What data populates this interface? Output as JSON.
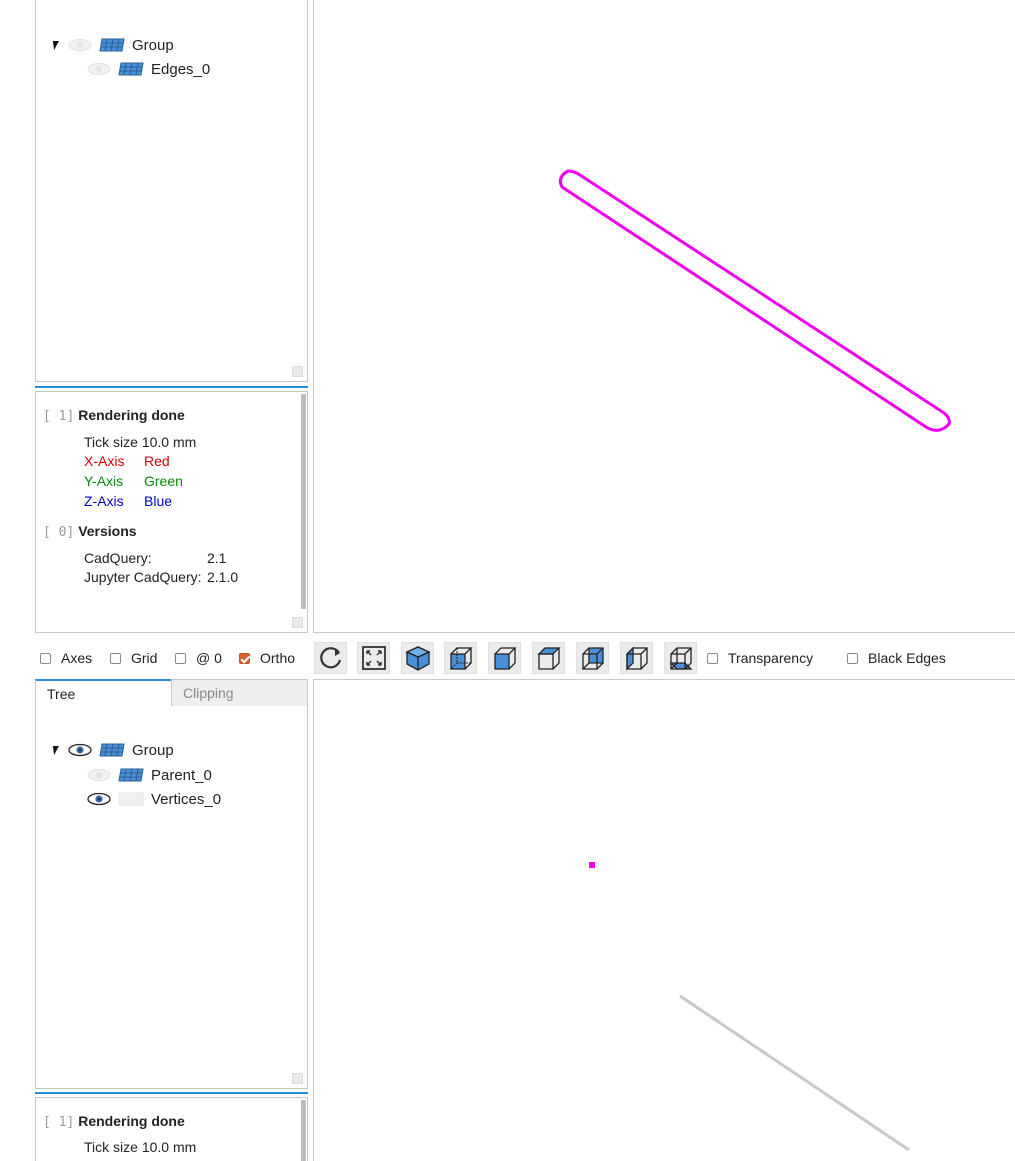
{
  "top_panel": {
    "tree": [
      {
        "label": "Group",
        "eye": "eye-hidden-icon",
        "shape": "shape-faces-icon",
        "expanded": true
      },
      {
        "label": "Edges_0",
        "eye": "eye-hidden-icon",
        "shape": "shape-faces-icon"
      }
    ],
    "log": {
      "entry1": {
        "index": "[ 1]",
        "title": "Rendering done"
      },
      "tick_label": "Tick size",
      "tick_value": "10.0 mm",
      "x_axis": "X-Axis",
      "x_color": "Red",
      "y_axis": "Y-Axis",
      "y_color": "Green",
      "z_axis": "Z-Axis",
      "z_color": "Blue",
      "entry0": {
        "index": "[ 0]",
        "title": "Versions"
      },
      "cadquery_label": "CadQuery:",
      "cadquery_value": "2.1",
      "jupyter_label": "Jupyter CadQuery:",
      "jupyter_value": "2.1.0"
    }
  },
  "toolbar": {
    "axes": {
      "label": "Axes",
      "checked": false
    },
    "grid": {
      "label": "Grid",
      "checked": false
    },
    "at_zero": {
      "label": "@ 0",
      "checked": false
    },
    "ortho": {
      "label": "Ortho",
      "checked": true
    },
    "transparency": {
      "label": "Transparency",
      "checked": false
    },
    "black_edges": {
      "label": "Black Edges",
      "checked": false
    },
    "buttons": [
      "reset-view-icon",
      "fit-view-icon",
      "isometric-view-icon",
      "front-view-icon",
      "rear-view-icon",
      "top-view-icon",
      "bottom-view-icon",
      "left-view-icon",
      "right-view-icon"
    ]
  },
  "bottom_panel": {
    "tabs": [
      {
        "label": "Tree",
        "active": true
      },
      {
        "label": "Clipping",
        "active": false
      }
    ],
    "tree": [
      {
        "label": "Group",
        "eye": "eye-visible-icon",
        "shape": "shape-faces-icon",
        "expanded": true
      },
      {
        "label": "Parent_0",
        "eye": "eye-hidden-icon",
        "shape": "shape-faces-icon"
      },
      {
        "label": "Vertices_0",
        "eye": "eye-visible-icon",
        "shape": "shape-empty-icon"
      }
    ],
    "log": {
      "entry1": {
        "index": "[ 1]",
        "title": "Rendering done"
      },
      "tick_label": "Tick size",
      "tick_value": "10.0 mm"
    }
  },
  "colors": {
    "edge": "#ee00ee",
    "accent": "#2a8fd6",
    "parent_edge": "#c8c8c8",
    "cube_blue": "#4a90d9"
  }
}
